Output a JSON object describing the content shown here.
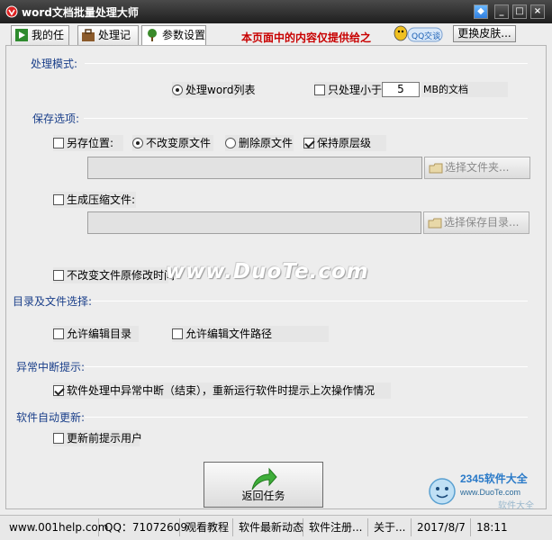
{
  "window": {
    "title": "word文档批量处理大师"
  },
  "tabs": [
    {
      "label": "我的任务"
    },
    {
      "label": "处理记录"
    },
    {
      "label": "参数设置"
    }
  ],
  "header": {
    "notice": "本页面中的内容仅提供给之",
    "qq_label": "QQ交谈",
    "skin_button": "更换皮肤..."
  },
  "sections": {
    "mode": "处理模式:",
    "save": "保存选项:",
    "dir": "目录及文件选择:",
    "abnormal": "异常中断提示:",
    "autoupdate": "软件自动更新:"
  },
  "mode": {
    "radio_list": "处理word列表",
    "only_small": "只处理小于",
    "size_value": "5",
    "size_suffix": "MB的文档"
  },
  "save": {
    "save_as": "另存位置:",
    "keep_original": "不改变原文件",
    "delete_original": "删除原文件",
    "keep_hierarchy": "保持原层级",
    "browse_folder": "选择文件夹...",
    "gen_archive": "生成压缩文件:",
    "browse_save": "选择保存目录...",
    "keep_mtime": "不改变文件原修改时间"
  },
  "dir": {
    "allow_edit_dir": "允许编辑目录",
    "allow_edit_path": "允许编辑文件路径"
  },
  "abnormal": {
    "prompt": "软件处理中异常中断（结束），重新运行软件时提示上次操作情况"
  },
  "autoupdate": {
    "prompt": "更新前提示用户"
  },
  "return_button": "返回任务",
  "watermark": "www.DuoTe.com",
  "logo": {
    "brand": "2345软件大全",
    "url": "www.DuoTe.com",
    "caption": "软件大全"
  },
  "status": {
    "site": "www.001help.com",
    "qq": "QQ：71072609",
    "tutorial": "观看教程",
    "news": "软件最新动态",
    "register": "软件注册...",
    "about": "关于...",
    "date": "2017/8/7",
    "time": "18:11"
  }
}
